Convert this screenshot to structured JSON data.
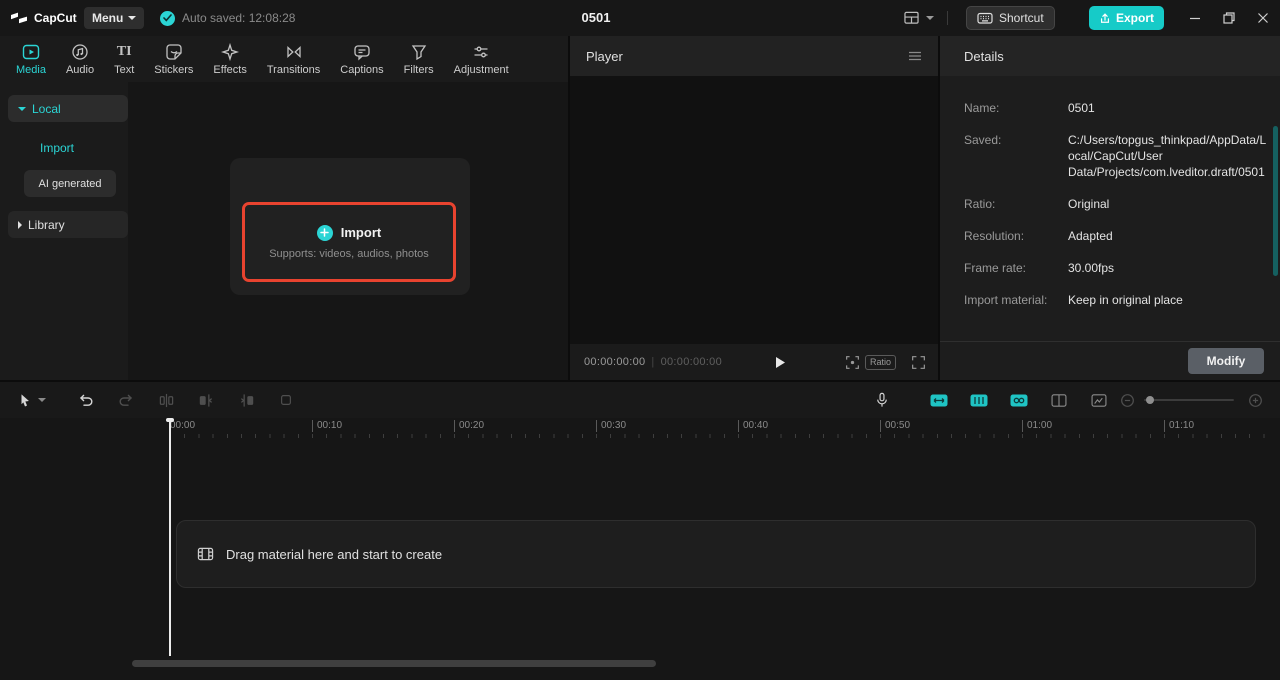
{
  "colors": {
    "accent": "#2bd5d5",
    "export_button": "#16cbc8",
    "highlight_border": "#e8432f",
    "modify_button": "#5a5f66"
  },
  "titlebar": {
    "logo_text": "CapCut",
    "menu_label": "Menu",
    "autosave_text": "Auto saved: 12:08:28",
    "project_title": "0501",
    "shortcut_label": "Shortcut",
    "export_label": "Export"
  },
  "tabs": [
    {
      "label": "Media",
      "active": true
    },
    {
      "label": "Audio",
      "active": false
    },
    {
      "label": "Text",
      "active": false,
      "icon_text": "TI"
    },
    {
      "label": "Stickers",
      "active": false
    },
    {
      "label": "Effects",
      "active": false
    },
    {
      "label": "Transitions",
      "active": false
    },
    {
      "label": "Captions",
      "active": false
    },
    {
      "label": "Filters",
      "active": false
    },
    {
      "label": "Adjustment",
      "active": false
    }
  ],
  "sidebar": {
    "local_label": "Local",
    "import_label": "Import",
    "ai_generated_label": "AI generated",
    "library_label": "Library"
  },
  "media_panel": {
    "import_button_label": "Import",
    "import_hint": "Supports: videos, audios, photos"
  },
  "player": {
    "title": "Player",
    "current_time": "00:00:00:00",
    "separator": "|",
    "total_time": "00:00:00:00",
    "ratio_label": "Ratio"
  },
  "details": {
    "title": "Details",
    "rows": [
      {
        "label": "Name:",
        "value": "0501"
      },
      {
        "label": "Saved:",
        "value": "C:/Users/topgus_thinkpad/AppData/Local/CapCut/User Data/Projects/com.lveditor.draft/0501"
      },
      {
        "label": "Ratio:",
        "value": "Original"
      },
      {
        "label": "Resolution:",
        "value": "Adapted"
      },
      {
        "label": "Frame rate:",
        "value": "30.00fps"
      },
      {
        "label": "Import material:",
        "value": "Keep in original place"
      }
    ],
    "modify_label": "Modify"
  },
  "timeline": {
    "ruler_ticks": [
      "00:00",
      "00:10",
      "00:20",
      "00:30",
      "00:40",
      "00:50",
      "01:00",
      "01:10"
    ],
    "dropzone_text": "Drag material here and start to create"
  }
}
